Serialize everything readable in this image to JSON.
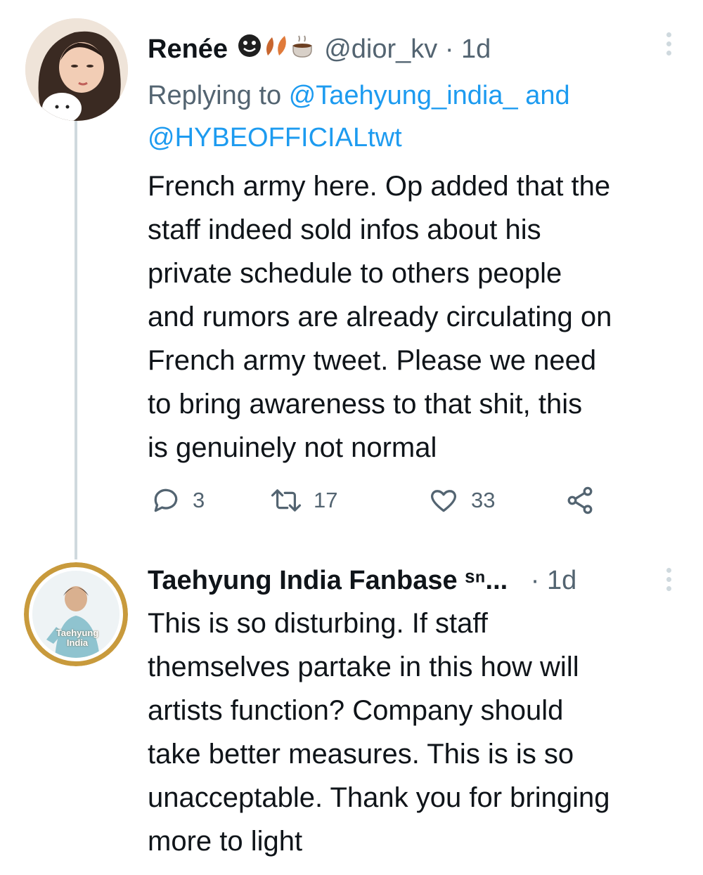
{
  "tweets": [
    {
      "display_name": "Renée",
      "name_emojis": [
        "smiley-icon",
        "leaf-icon",
        "leaf-icon",
        "coffee-icon"
      ],
      "handle": "@dior_kv",
      "separator": "·",
      "time": "1d",
      "replying_prefix": "Replying to",
      "reply_mention_1": "@Taehyung_india_",
      "reply_and": "and",
      "reply_mention_2": "@HYBEOFFICIALtwt",
      "text_lines": [
        "French army here. Op added that the",
        "staff indeed sold infos about his",
        "private schedule to others people",
        "and rumors are already circulating on",
        "French army tweet. Please we need",
        "to bring awareness to that shit, this",
        "is genuinely not normal"
      ],
      "actions": {
        "replies": "3",
        "retweets": "17",
        "likes": "33"
      }
    },
    {
      "display_name": "Taehyung India Fanbase",
      "name_suffix": "ˢⁿ...",
      "separator": "·",
      "time": "1d",
      "avatar_text": "Taehyung India",
      "text_lines": [
        "This is so disturbing. If staff",
        "themselves partake in this how will",
        "artists function? Company should",
        "take better measures. This is is so",
        "unacceptable. Thank you for bringing",
        "more to light"
      ]
    }
  ],
  "colors": {
    "text": "#0f1419",
    "secondary": "#536471",
    "link": "#1d9bf0",
    "thread_line": "#cfd9de",
    "avatar_ring": "#c89a3c"
  }
}
